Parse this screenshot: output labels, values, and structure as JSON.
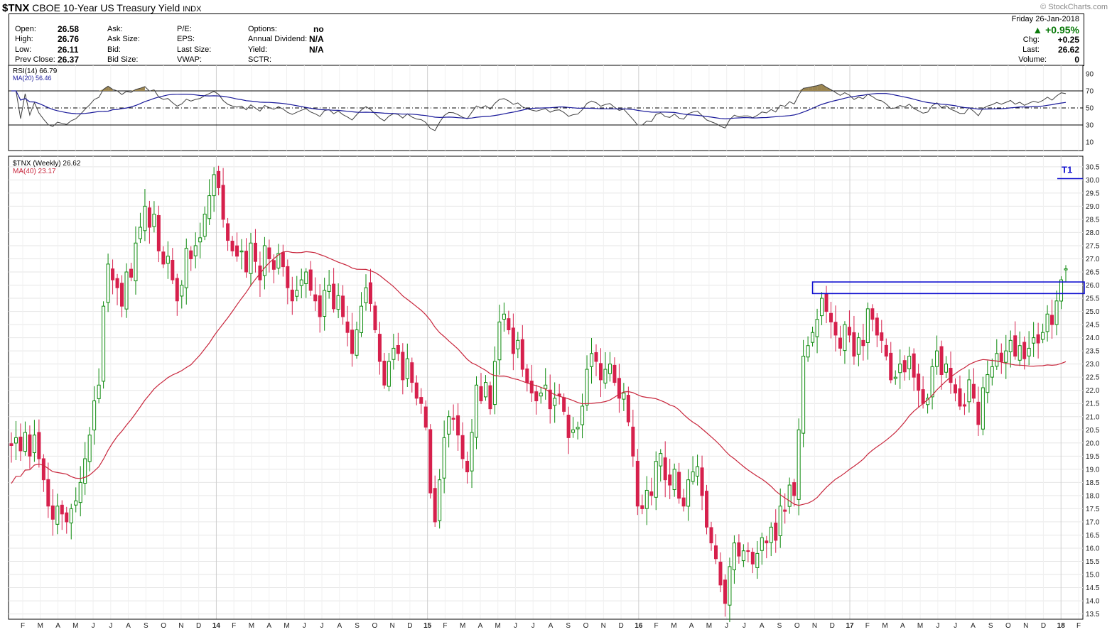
{
  "header": {
    "symbol": "$TNX",
    "name": "CBOE 10-Year US Treasury Yield",
    "exchange": "INDX",
    "brand": "© StockCharts.com"
  },
  "quote": {
    "col1": [
      {
        "label": "Open:",
        "value": "26.58"
      },
      {
        "label": "High:",
        "value": "26.76"
      },
      {
        "label": "Low:",
        "value": "26.11"
      },
      {
        "label": "Prev Close:",
        "value": "26.37"
      }
    ],
    "col2": [
      "Ask:",
      "Ask Size:",
      "Bid:",
      "Bid Size:"
    ],
    "col3": [
      "P/E:",
      "EPS:",
      "Last Size:",
      "VWAP:"
    ],
    "col4": [
      {
        "label": "Options:",
        "value": "no"
      },
      {
        "label": "Annual Dividend:",
        "value": "N/A"
      },
      {
        "label": "Yield:",
        "value": "N/A"
      },
      {
        "label": "SCTR:",
        "value": ""
      }
    ],
    "date": "Friday  26-Jan-2018",
    "pct_change": "+0.95%",
    "right": [
      {
        "label": "Chg:",
        "value": "+0.25"
      },
      {
        "label": "Last:",
        "value": "26.62"
      },
      {
        "label": "Volume:",
        "value": "0"
      }
    ]
  },
  "rsi_panel": {
    "legend_rsi": "RSI(14) 66.79",
    "legend_ma": "MA(20) 56.46",
    "ticks": [
      "90",
      "70",
      "50",
      "30",
      "10"
    ]
  },
  "price_panel": {
    "legend_price": "$TNX (Weekly) 26.62",
    "legend_ma": "MA(40) 23.17",
    "target_label": "T1"
  },
  "colors": {
    "up": "#0d8a0d",
    "down": "#d6204c",
    "ma40": "#c8263c",
    "rsi_line": "#404040",
    "rsi_ma": "#1a1a9a",
    "annotation": "#1010d0",
    "overbought_fill": "#9b8550",
    "grid": "#e6e6e6"
  },
  "chart_data": {
    "type": "candlestick",
    "timeframe": "Weekly",
    "ylim": [
      13.3,
      30.9
    ],
    "y_ticks": [
      13.5,
      14.0,
      14.5,
      15.0,
      15.5,
      16.0,
      16.5,
      17.0,
      17.5,
      18.0,
      18.5,
      19.0,
      19.5,
      20.0,
      20.5,
      21.0,
      21.5,
      22.0,
      22.5,
      23.0,
      23.5,
      24.0,
      24.5,
      25.0,
      25.5,
      26.0,
      26.5,
      27.0,
      27.5,
      28.0,
      28.5,
      29.0,
      29.5,
      30.0,
      30.5
    ],
    "x_ticks": [
      "F",
      "M",
      "A",
      "M",
      "J",
      "J",
      "A",
      "S",
      "O",
      "N",
      "D",
      "14",
      "F",
      "M",
      "A",
      "M",
      "J",
      "J",
      "A",
      "S",
      "O",
      "N",
      "D",
      "15",
      "F",
      "M",
      "A",
      "M",
      "J",
      "J",
      "A",
      "S",
      "O",
      "N",
      "D",
      "16",
      "F",
      "M",
      "A",
      "M",
      "J",
      "J",
      "A",
      "S",
      "O",
      "N",
      "D",
      "17",
      "F",
      "M",
      "A",
      "M",
      "J",
      "J",
      "A",
      "S",
      "O",
      "N",
      "D",
      "18",
      "F"
    ],
    "last_bar": {
      "date": "26-Jan-2018",
      "open": 26.58,
      "high": 26.76,
      "low": 26.11,
      "close": 26.62
    },
    "closes": [
      19.9,
      20.2,
      19.7,
      20.4,
      19.5,
      20.3,
      19.4,
      18.6,
      17.6,
      17.1,
      17.6,
      17.3,
      17.0,
      17.5,
      17.8,
      18.5,
      19.4,
      20.3,
      21.6,
      22.2,
      25.2,
      26.8,
      26.2,
      25.9,
      25.2,
      26.5,
      26.3,
      27.6,
      28.2,
      29.0,
      28.2,
      28.7,
      27.3,
      26.8,
      27.1,
      26.2,
      25.4,
      26.0,
      27.4,
      27.0,
      27.5,
      27.8,
      28.7,
      29.4,
      30.2,
      29.7,
      28.5,
      27.7,
      27.3,
      27.1,
      27.3,
      26.5,
      27.6,
      26.9,
      26.2,
      27.5,
      27.0,
      26.6,
      27.2,
      26.7,
      25.9,
      25.4,
      25.8,
      26.2,
      26.5,
      25.8,
      25.4,
      24.8,
      25.8,
      26.0,
      25.1,
      25.6,
      24.8,
      24.2,
      23.4,
      24.3,
      25.2,
      25.9,
      25.3,
      24.3,
      23.1,
      22.2,
      23.1,
      23.6,
      23.4,
      22.4,
      23.2,
      22.3,
      21.7,
      21.5,
      20.6,
      18.1,
      17.0,
      18.6,
      20.2,
      21.0,
      20.9,
      20.3,
      19.4,
      18.9,
      20.4,
      22.2,
      21.6,
      22.3,
      21.3,
      23.1,
      24.6,
      24.9,
      24.3,
      23.4,
      23.9,
      22.8,
      22.3,
      21.9,
      21.6,
      21.9,
      22.2,
      21.3,
      21.7,
      21.8,
      21.2,
      20.2,
      20.5,
      20.6,
      21.4,
      22.8,
      23.4,
      23.1,
      22.4,
      22.8,
      23.0,
      22.3,
      21.7,
      21.9,
      20.8,
      19.5,
      17.6,
      17.5,
      18.2,
      18.0,
      19.3,
      19.6,
      18.6,
      18.4,
      19.0,
      17.9,
      17.6,
      18.6,
      18.9,
      19.1,
      18.0,
      16.8,
      16.2,
      15.6,
      14.6,
      13.9,
      15.3,
      16.2,
      15.7,
      15.9,
      15.9,
      15.4,
      15.8,
      16.4,
      16.2,
      16.8,
      16.3,
      17.6,
      17.4,
      18.4,
      18.0,
      20.5,
      23.3,
      23.7,
      24.2,
      24.7,
      25.5,
      25.0,
      24.6,
      24.1,
      23.6,
      24.5,
      24.1,
      23.3,
      24.0,
      23.7,
      25.1,
      24.7,
      24.1,
      23.9,
      23.3,
      22.4,
      22.5,
      23.0,
      22.7,
      23.3,
      22.5,
      22.0,
      21.5,
      21.7,
      22.9,
      23.5,
      22.6,
      23.0,
      22.3,
      21.9,
      21.4,
      21.4,
      22.4,
      21.7,
      20.7,
      22.1,
      22.6,
      22.9,
      23.4,
      23.1,
      23.5,
      23.9,
      23.3,
      23.7,
      23.2,
      23.6,
      24.0,
      23.8,
      24.2,
      24.9,
      24.5,
      25.4,
      26.2,
      26.62
    ],
    "ma40_series": "MA(40)",
    "resistance_level": 25.9,
    "target_T1": 30.05,
    "rsi": {
      "ylim": [
        0,
        100
      ],
      "levels": [
        30,
        50,
        70
      ],
      "last_rsi": 66.79,
      "last_ma20": 56.46
    }
  }
}
